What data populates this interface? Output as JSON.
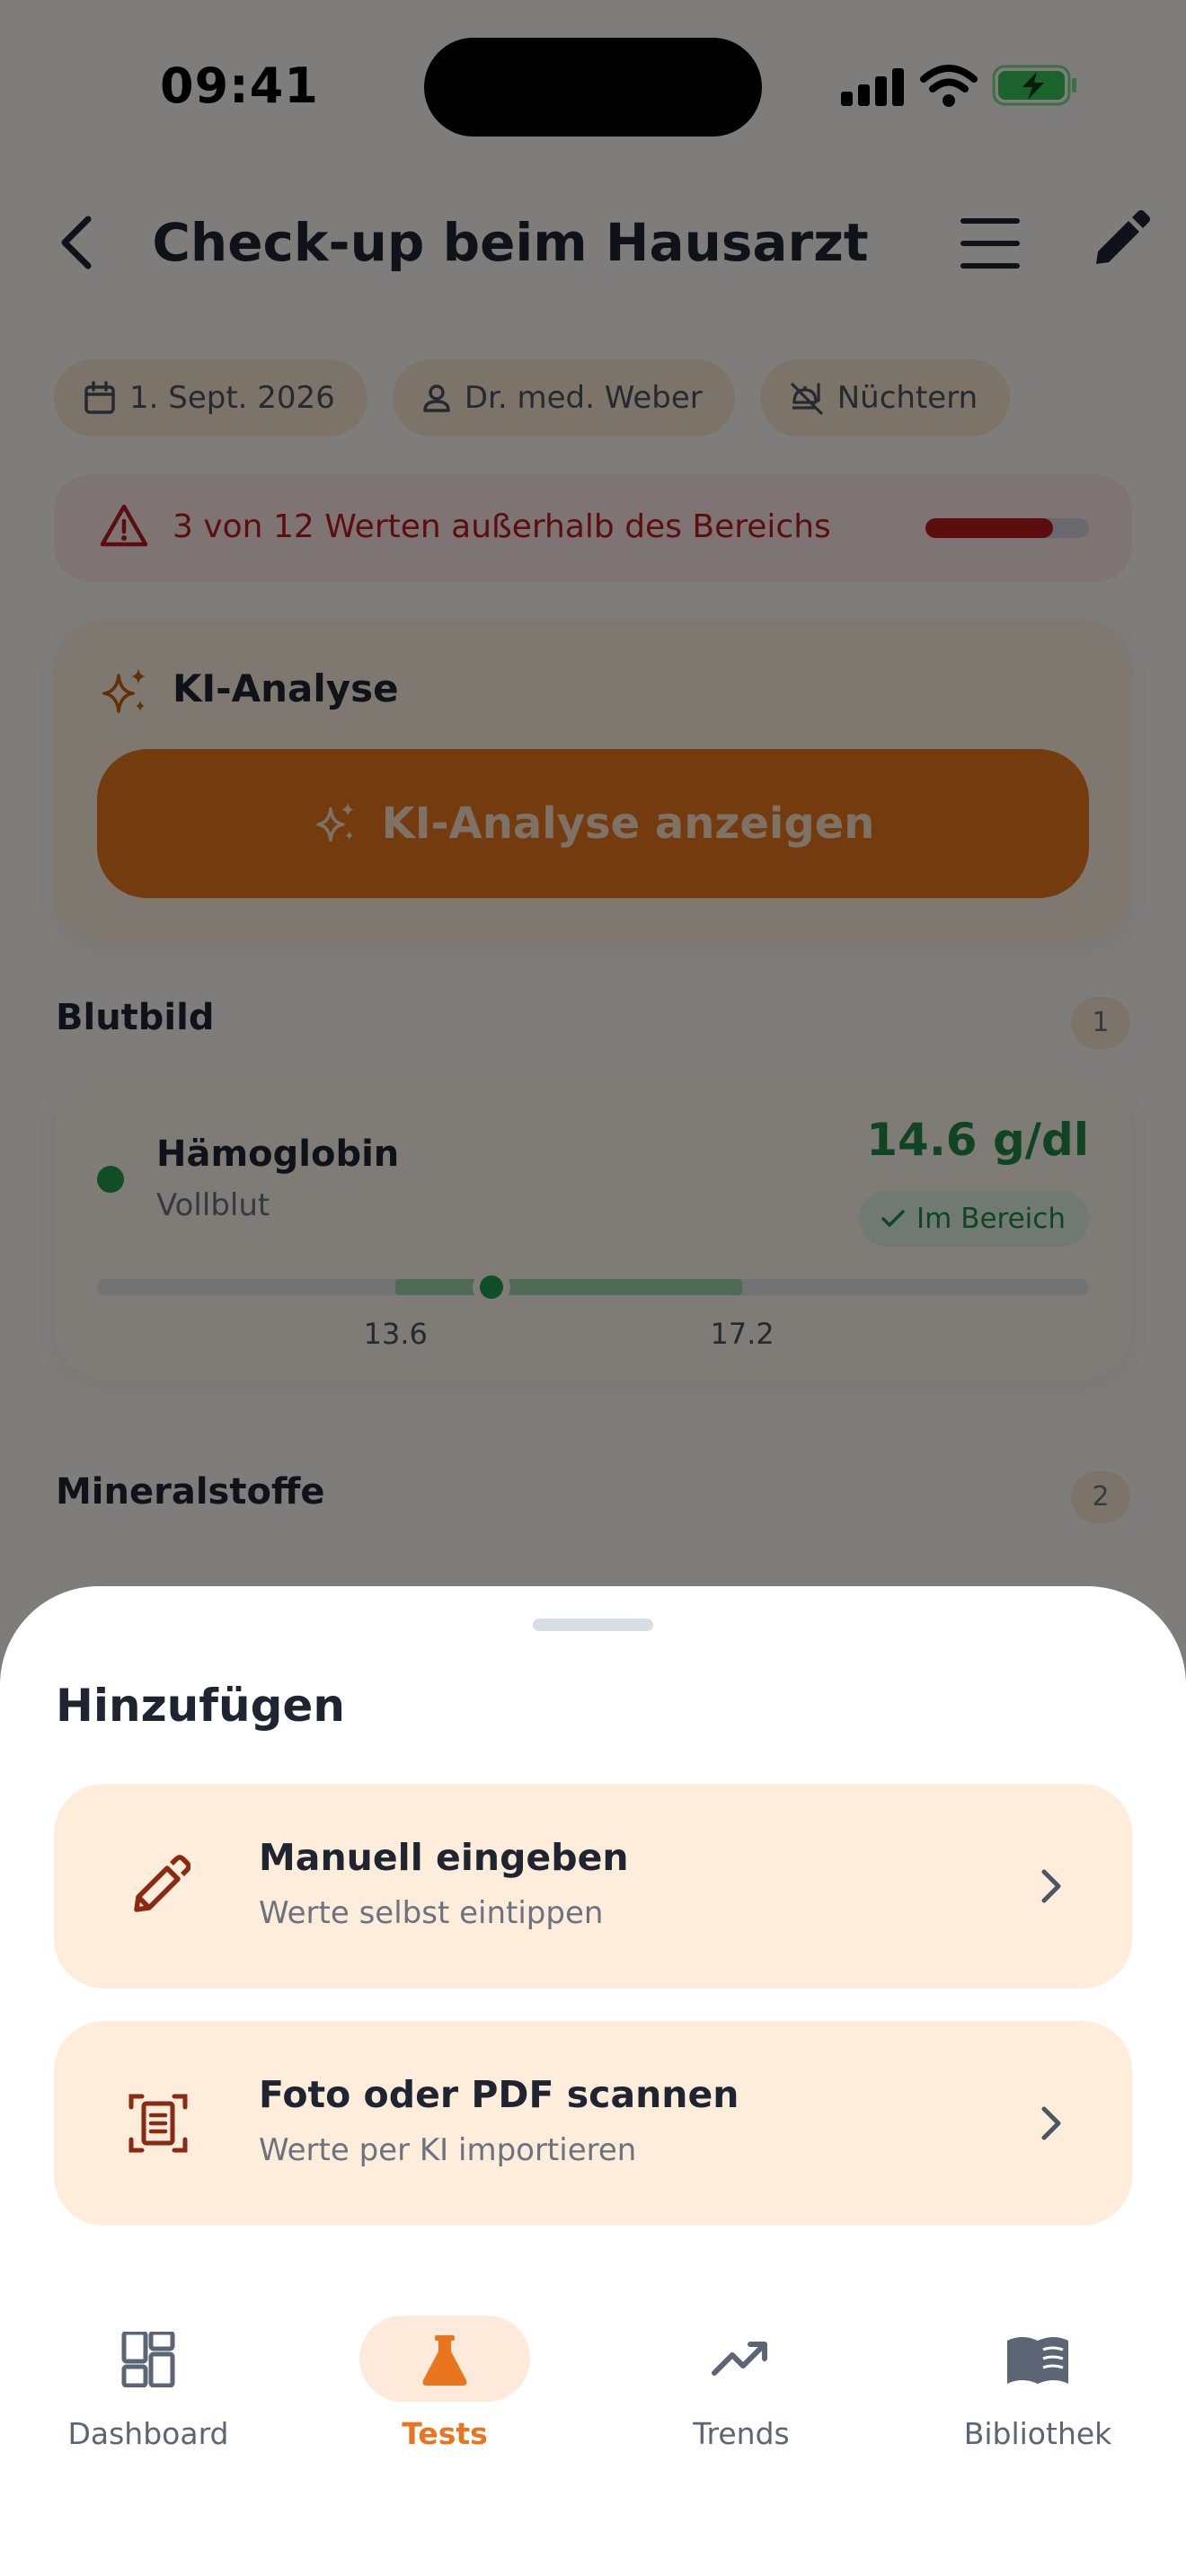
{
  "status_bar": {
    "time": "09:41"
  },
  "header": {
    "title": "Check-up beim Hausarzt"
  },
  "chips": [
    {
      "icon": "calendar-icon",
      "label": "1. Sept. 2026"
    },
    {
      "icon": "person-icon",
      "label": "Dr. med. Weber"
    },
    {
      "icon": "no-food-icon",
      "label": "Nüchtern"
    }
  ],
  "alert": {
    "text": "3 von 12 Werten außerhalb des Bereichs",
    "out_of_range_fraction": 0.78,
    "color": "#b91c1c"
  },
  "ai_card": {
    "title": "KI-Analyse",
    "button_label": "KI-Analyse anzeigen",
    "accent": "#e9761f"
  },
  "sections": [
    {
      "title": "Blutbild",
      "count": "1"
    },
    {
      "title": "Mineralstoffe",
      "count": "2"
    }
  ],
  "result": {
    "name": "Hämoglobin",
    "specimen": "Vollblut",
    "value": "14.6 g/dl",
    "status": "Im Bereich",
    "status_color": "#1f8a44",
    "range_low": "13.6",
    "range_high": "17.2",
    "scale_min": 10.5,
    "scale_max": 20.8,
    "numeric_value": 14.6
  },
  "sheet": {
    "title": "Hinzufügen",
    "options": [
      {
        "icon": "pencil-icon",
        "title": "Manuell eingeben",
        "subtitle": "Werte selbst eintippen"
      },
      {
        "icon": "document-scan-icon",
        "title": "Foto oder PDF scannen",
        "subtitle": "Werte per KI importieren"
      }
    ]
  },
  "tabbar": {
    "active": "Tests",
    "tabs": [
      {
        "icon": "dashboard-icon",
        "label": "Dashboard"
      },
      {
        "icon": "flask-icon",
        "label": "Tests"
      },
      {
        "icon": "trend-icon",
        "label": "Trends"
      },
      {
        "icon": "book-icon",
        "label": "Bibliothek"
      }
    ]
  }
}
